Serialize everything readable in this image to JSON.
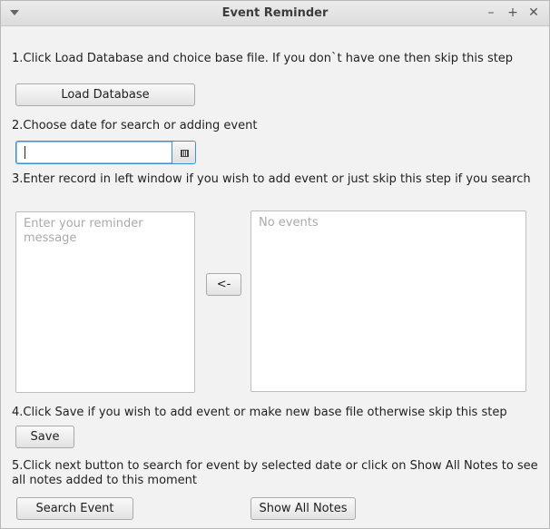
{
  "window": {
    "title": "Event Reminder"
  },
  "titlebar": {
    "minimize": "–",
    "maximize": "+",
    "close": "✕"
  },
  "step1": {
    "text": "1.Click Load Database and choice base file. If you don`t have one then skip this step",
    "button": "Load Database"
  },
  "step2": {
    "text": "2.Choose date for search or adding event",
    "date_value": ""
  },
  "step3": {
    "text": "3.Enter record in left window if you wish to add event or just skip this step if you search",
    "reminder_placeholder": "Enter your reminder message",
    "arrow_button": "<-",
    "events_placeholder": "No events"
  },
  "step4": {
    "text": "4.Click Save if you wish to add event or make new base file otherwise skip this step",
    "button": "Save"
  },
  "step5": {
    "text": "5.Click next button to search for event by selected date or click on Show All Notes to see all notes added to this moment",
    "search_button": "Search Event",
    "show_all_button": "Show All Notes"
  }
}
